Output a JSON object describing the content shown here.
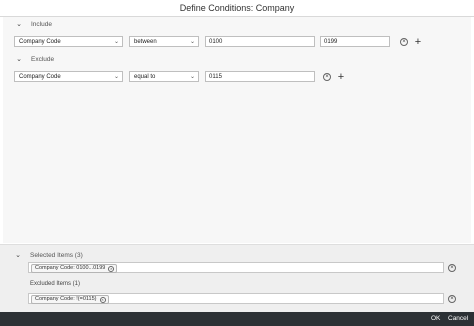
{
  "dialog": {
    "title": "Define Conditions: Company"
  },
  "include": {
    "label": "Include",
    "field": "Company Code",
    "operator": "between",
    "value_from": "0100",
    "value_to": "0199"
  },
  "exclude": {
    "label": "Exclude",
    "field": "Company Code",
    "operator": "equal to",
    "value": "0115"
  },
  "summary": {
    "selected_label": "Selected Items (3)",
    "selected_token": "Company Code: 0100...0199",
    "excluded_label": "Excluded Items (1)",
    "excluded_token": "Company Code: !(=0115)"
  },
  "footer": {
    "ok_label": "OK",
    "cancel_label": "Cancel"
  },
  "colors": {
    "footer_bg": "#2c3135",
    "panel_bg": "#f7f7f7",
    "summary_bg": "#efefef"
  }
}
